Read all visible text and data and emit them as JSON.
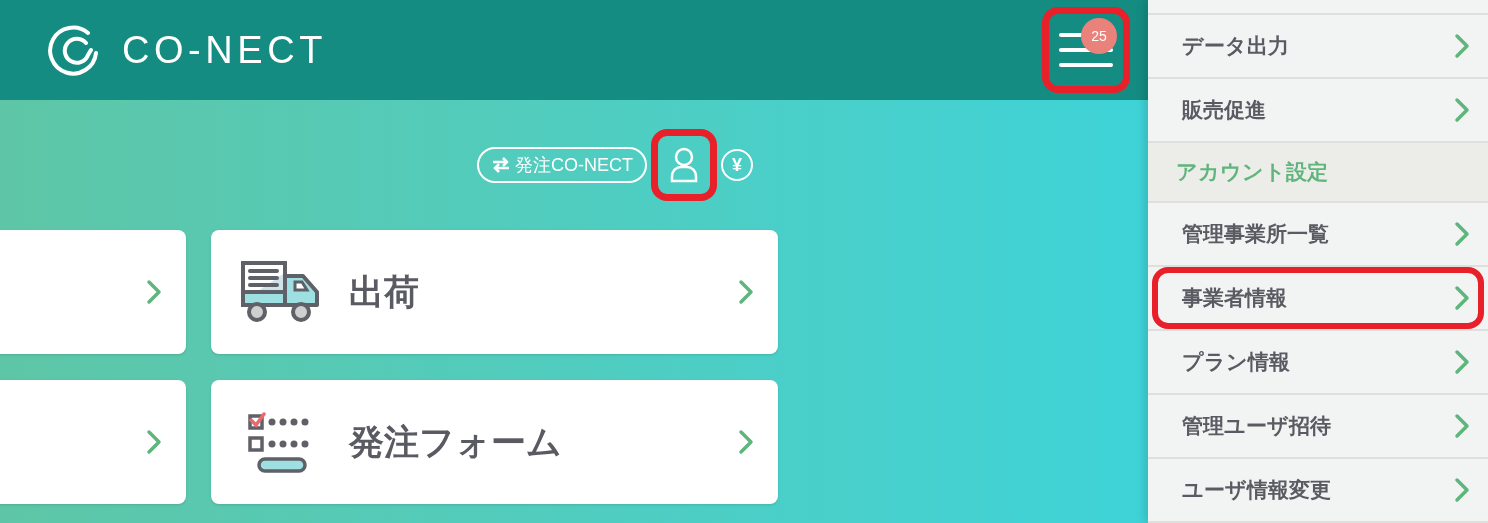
{
  "header": {
    "logo": "CO-NECT",
    "menu_button": {
      "badge": "25",
      "highlighted": true
    }
  },
  "toolbar": {
    "switch_link": "発注CO-NECT",
    "account_button": {
      "highlighted": true
    },
    "yen_label": "¥"
  },
  "cards": [
    {
      "kind": "partial"
    },
    {
      "kind": "shipping",
      "title": "出荷"
    },
    {
      "kind": "partial"
    },
    {
      "kind": "order_form",
      "title": "発注フォーム"
    }
  ],
  "sidebar": {
    "items": [
      {
        "kind": "link",
        "label": "データ出力",
        "highlighted": false
      },
      {
        "kind": "link",
        "label": "販売促進",
        "highlighted": false
      },
      {
        "kind": "section",
        "label": "アカウント設定"
      },
      {
        "kind": "link",
        "label": "管理事業所一覧",
        "highlighted": false
      },
      {
        "kind": "link",
        "label": "事業者情報",
        "highlighted": true
      },
      {
        "kind": "link",
        "label": "プラン情報",
        "highlighted": false
      },
      {
        "kind": "link",
        "label": "管理ユーザ招待",
        "highlighted": false
      },
      {
        "kind": "link",
        "label": "ユーザ情報変更",
        "highlighted": false
      }
    ]
  }
}
